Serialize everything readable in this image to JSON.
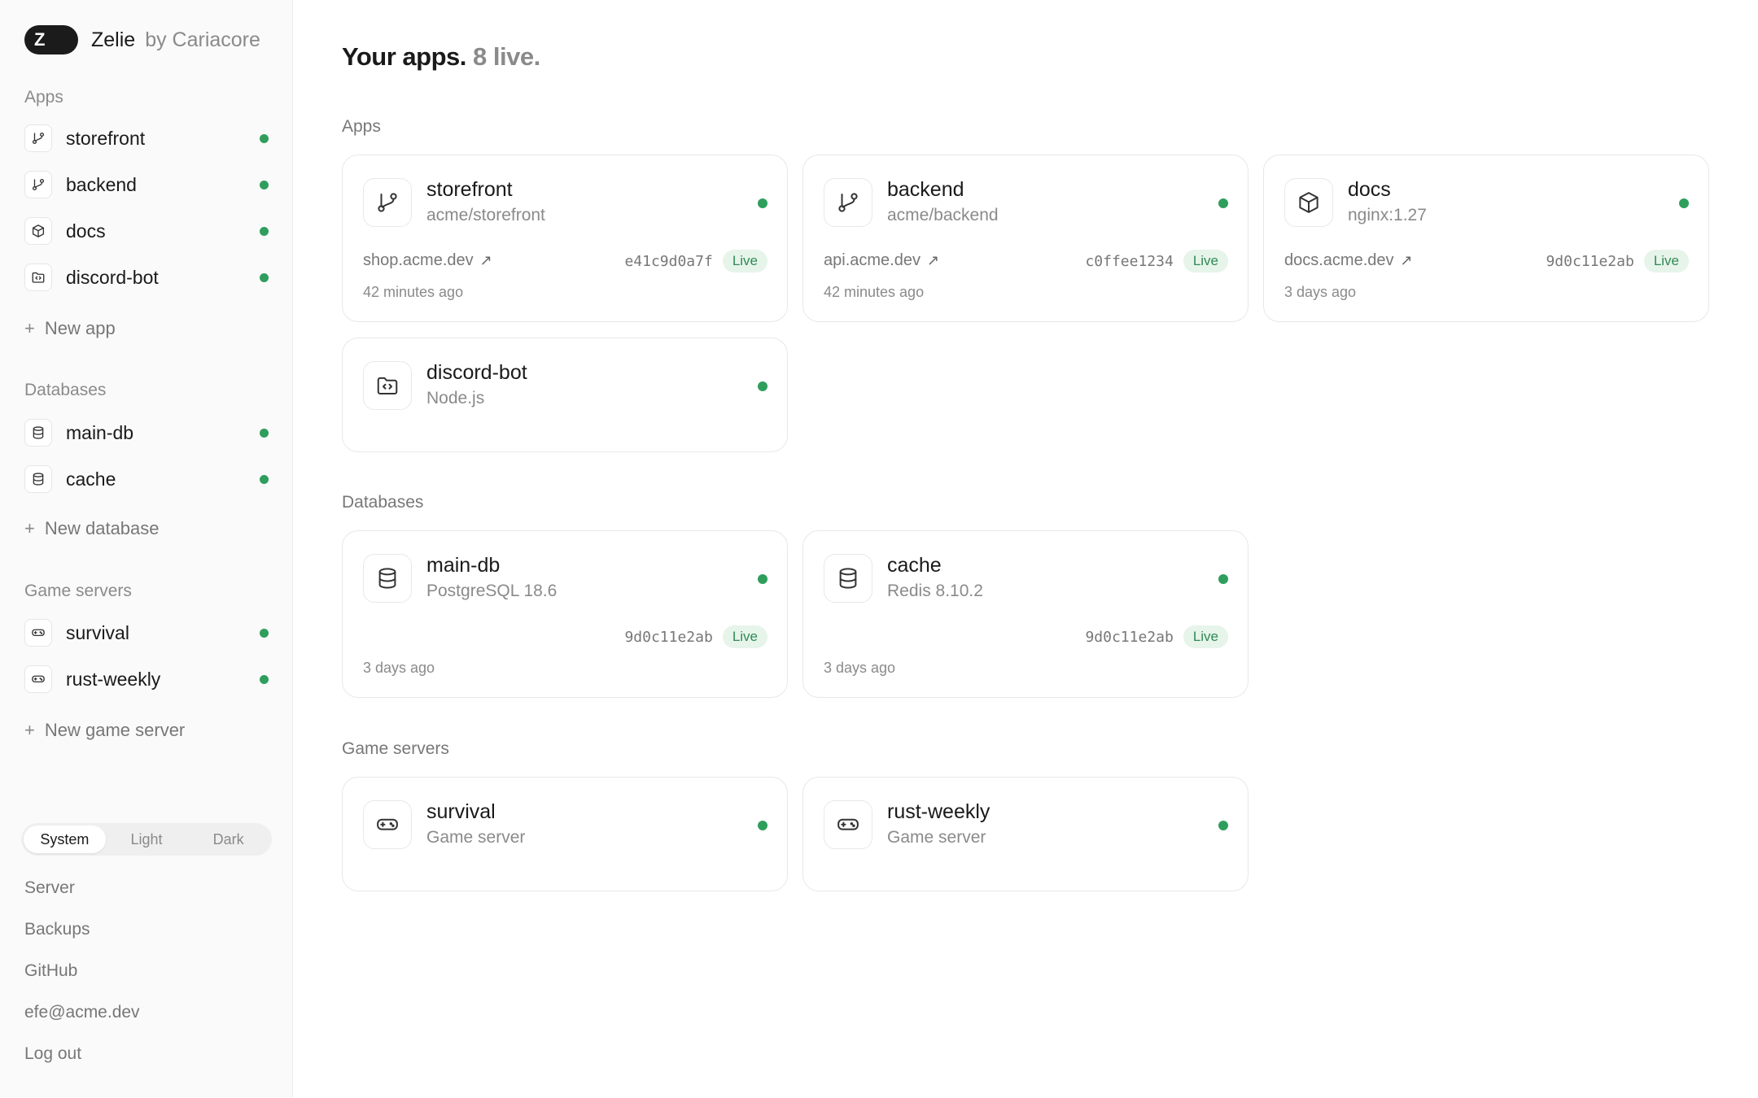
{
  "brand": {
    "logo_letter": "Z",
    "name": "Zelie",
    "by": "by Cariacore"
  },
  "sidebar": {
    "sections": [
      {
        "title": "Apps",
        "items": [
          {
            "label": "storefront",
            "icon": "git-branch-icon",
            "status": "live"
          },
          {
            "label": "backend",
            "icon": "git-branch-icon",
            "status": "live"
          },
          {
            "label": "docs",
            "icon": "package-icon",
            "status": "live"
          },
          {
            "label": "discord-bot",
            "icon": "folder-code-icon",
            "status": "live"
          }
        ],
        "new_label": "New app"
      },
      {
        "title": "Databases",
        "items": [
          {
            "label": "main-db",
            "icon": "database-icon",
            "status": "live"
          },
          {
            "label": "cache",
            "icon": "database-icon",
            "status": "live"
          }
        ],
        "new_label": "New database"
      },
      {
        "title": "Game servers",
        "items": [
          {
            "label": "survival",
            "icon": "gamepad-icon",
            "status": "live"
          },
          {
            "label": "rust-weekly",
            "icon": "gamepad-icon",
            "status": "live"
          }
        ],
        "new_label": "New game server"
      }
    ],
    "theme": {
      "options": [
        "System",
        "Light",
        "Dark"
      ],
      "selected": "System"
    },
    "footer_links": [
      "Server",
      "Backups",
      "GitHub",
      "efe@acme.dev",
      "Log out"
    ]
  },
  "main": {
    "title": "Your apps.",
    "live_count": "8 live.",
    "sections": [
      {
        "title": "Apps",
        "cards": [
          {
            "name": "storefront",
            "sub": "acme/storefront",
            "icon": "git-branch-icon",
            "url": "shop.acme.dev",
            "hash": "e41c9d0a7f",
            "badge": "Live",
            "time": "42 minutes ago"
          },
          {
            "name": "backend",
            "sub": "acme/backend",
            "icon": "git-branch-icon",
            "url": "api.acme.dev",
            "hash": "c0ffee1234",
            "badge": "Live",
            "time": "42 minutes ago"
          },
          {
            "name": "docs",
            "sub": "nginx:1.27",
            "icon": "package-icon",
            "url": "docs.acme.dev",
            "hash": "9d0c11e2ab",
            "badge": "Live",
            "time": "3 days ago"
          },
          {
            "name": "discord-bot",
            "sub": "Node.js",
            "icon": "folder-code-icon"
          }
        ]
      },
      {
        "title": "Databases",
        "cards": [
          {
            "name": "main-db",
            "sub": "PostgreSQL 18.6",
            "icon": "database-icon",
            "hash": "9d0c11e2ab",
            "badge": "Live",
            "time": "3 days ago"
          },
          {
            "name": "cache",
            "sub": "Redis 8.10.2",
            "icon": "database-icon",
            "hash": "9d0c11e2ab",
            "badge": "Live",
            "time": "3 days ago"
          }
        ]
      },
      {
        "title": "Game servers",
        "cards": [
          {
            "name": "survival",
            "sub": "Game server",
            "icon": "gamepad-icon"
          },
          {
            "name": "rust-weekly",
            "sub": "Game server",
            "icon": "gamepad-icon"
          }
        ]
      }
    ]
  },
  "colors": {
    "live_green": "#2f9e5d",
    "badge_bg": "#e6f4ea",
    "badge_text": "#2f8a55",
    "sidebar_bg": "#fafafa"
  }
}
